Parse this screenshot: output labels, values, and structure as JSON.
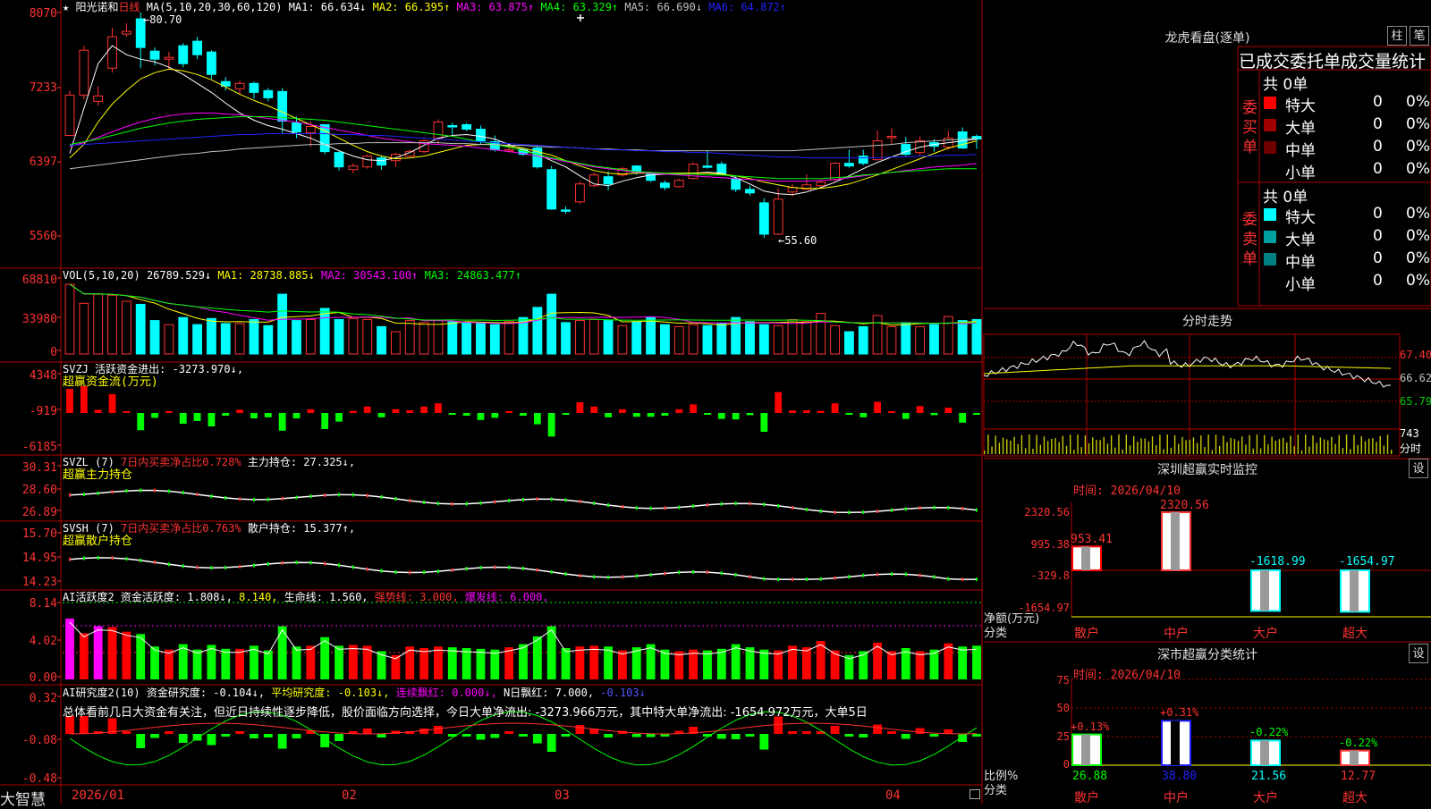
{
  "stock": {
    "star": "★",
    "name": "阳光诺和",
    "period": "日线",
    "ma_header": "MA(5,10,20,30,60,120)",
    "ma_values": [
      {
        "label": "MA1: 66.634↓",
        "color": "#ffffff"
      },
      {
        "label": "MA2: 66.395↑",
        "color": "#ffff00"
      },
      {
        "label": "MA3: 63.875↑",
        "color": "#ff00ff"
      },
      {
        "label": "MA4: 63.329↑",
        "color": "#00ff00"
      },
      {
        "label": "MA5: 66.690↓",
        "color": "#c0c0c0"
      },
      {
        "label": "MA6: 64.872↑",
        "color": "#2222ff"
      }
    ],
    "hi_label": "80.70",
    "lo_label": "55.60",
    "price_axis": [
      "8070",
      "7233",
      "6397",
      "5560"
    ]
  },
  "vol": {
    "header": "VOL(5,10,20)",
    "value": "26789.529↓",
    "ma": [
      {
        "label": "MA1: 28738.885↓",
        "color": "#ffff00"
      },
      {
        "label": "MA2: 30543.100↑",
        "color": "#ff00ff"
      },
      {
        "label": "MA3: 24863.477↑",
        "color": "#00ff00"
      }
    ],
    "axis": [
      "68810",
      "33980",
      "0"
    ]
  },
  "svzj": {
    "header": "SVZJ  活跃资金进出: -3273.970↓,",
    "sub": "超赢资金流(万元)",
    "axis": [
      "4348",
      "-919",
      "-6185"
    ]
  },
  "svzl": {
    "header1": "SVZL (7)",
    "header2": "7日内买卖净占比0.728%",
    "header3": "主力持仓: 27.325↓,",
    "sub": "超赢主力持仓",
    "axis": [
      "30.31",
      "28.60",
      "26.89"
    ]
  },
  "svsh": {
    "header1": "SVSH (7)",
    "header2": "7日内买卖净占比0.763%",
    "header3": "散户持仓: 15.377↑,",
    "sub": "超赢散户持仓",
    "axis": [
      "15.70",
      "14.95",
      "14.23"
    ]
  },
  "ai_active": {
    "header": "AI活跃度2",
    "parts": [
      {
        "label": "资金活跃度: 1.808↓,",
        "color": "#ffffff"
      },
      {
        "label": "8.140,",
        "color": "#ffff00"
      },
      {
        "label": "生命线: 1.560,",
        "color": "#ffffff"
      },
      {
        "label": "强势线: 3.000,",
        "color": "#ff3232"
      },
      {
        "label": "爆发线: 6.000,",
        "color": "#ff00ff"
      }
    ],
    "axis": [
      "8.14",
      "4.02",
      "0.00"
    ]
  },
  "ai_research": {
    "header": "AI研究度2(10)",
    "parts": [
      {
        "label": "资金研究度: -0.104↓,",
        "color": "#ffffff"
      },
      {
        "label": "平均研究度: -0.103↓,",
        "color": "#ffff00"
      },
      {
        "label": "连续飘红: 0.000↓,",
        "color": "#ff00ff"
      },
      {
        "label": "N日飘红: 7.000,",
        "color": "#ffffff"
      },
      {
        "label": "-0.103↓",
        "color": "#5555ff"
      }
    ],
    "description": "总体看前几日大资金有关注，但近日持续性逐步降低，股价面临方向选择，今日大单净流出: -3273.966万元，其中特大单净流出: -1654.972万元，大单5日",
    "axis": [
      "0.32",
      "-0.08",
      "-0.48"
    ]
  },
  "date_axis": [
    "2026/01",
    "02",
    "03",
    "04"
  ],
  "brand": "大智慧",
  "right_panel": {
    "dragon_title": "龙虎看盘(逐单)",
    "tab_zhu": "柱",
    "tab_bi": "笔",
    "table_header": "已成交委托单成交量统计",
    "buy_label": "委买单",
    "sell_label": "委卖单",
    "buy_total": "共 0单",
    "sell_total": "共 0单",
    "buy_rows": [
      {
        "name": "特大",
        "count": "0",
        "pct": "0%",
        "color": "#ff0000"
      },
      {
        "name": "大单",
        "count": "0",
        "pct": "0%",
        "color": "#a00000"
      },
      {
        "name": "中单",
        "count": "0",
        "pct": "0%",
        "color": "#700000"
      },
      {
        "name": "小单",
        "count": "0",
        "pct": "0%",
        "color": "#000000"
      }
    ],
    "sell_rows": [
      {
        "name": "特大",
        "count": "0",
        "pct": "0%",
        "color": "#00ffff"
      },
      {
        "name": "大单",
        "count": "0",
        "pct": "0%",
        "color": "#00a0a0"
      },
      {
        "name": "中单",
        "count": "0",
        "pct": "0%",
        "color": "#008080"
      },
      {
        "name": "小单",
        "count": "0",
        "pct": "0%",
        "color": "#000000"
      }
    ],
    "intraday": {
      "title": "分时走势",
      "price_axis": [
        "67.40",
        "66.62",
        "65.79"
      ],
      "vol_label": "743",
      "unit": "分时"
    },
    "monitor": {
      "title": "深圳超赢实时监控",
      "set": "设",
      "time": "时间: 2026/04/10",
      "axis": [
        "2320.56",
        "995.38",
        "-329.8",
        "-1654.97"
      ],
      "bar_values": [
        "953.41",
        "2320.56",
        "-1618.99",
        "-1654.97"
      ],
      "y_unit1": "净额(万元)",
      "y_unit2": "分类",
      "categories": [
        "散户",
        "中户",
        "大户",
        "超大"
      ]
    },
    "classify": {
      "title": "深市超赢分类统计",
      "set": "设",
      "time": "时间: 2026/04/10",
      "axis": [
        "75",
        "50",
        "25",
        "0"
      ],
      "deltas": [
        "+0.13%",
        "+0.31%",
        "-0.22%",
        "-0.22%"
      ],
      "values": [
        "26.88",
        "38.80",
        "21.56",
        "12.77"
      ],
      "y_unit1": "比例%",
      "y_unit2": "分类",
      "categories": [
        "散户",
        "中户",
        "大户",
        "超大"
      ]
    }
  },
  "chart_data": {
    "type": "candlestick",
    "dates": [
      "2026/01",
      "02",
      "03",
      "04"
    ],
    "ylim": [
      55.6,
      80.7
    ],
    "candles": [
      [
        67.0,
        71.5,
        67.0,
        72.0
      ],
      [
        71.5,
        76.5,
        71.0,
        77.0
      ],
      [
        70.8,
        71.4,
        70.3,
        72.5
      ],
      [
        74.5,
        78.0,
        74.0,
        79.0
      ],
      [
        78.3,
        78.6,
        78.0,
        79.5
      ],
      [
        80.0,
        76.8,
        74.5,
        80.7
      ],
      [
        76.4,
        75.5,
        74.8,
        76.8
      ],
      [
        75.5,
        75.7,
        74.3,
        76.3
      ],
      [
        77.0,
        75.0,
        74.6,
        77.3
      ],
      [
        77.5,
        76.0,
        75.5,
        78.0
      ],
      [
        76.3,
        73.8,
        73.3,
        76.5
      ],
      [
        73.0,
        72.5,
        72.0,
        73.5
      ],
      [
        72.2,
        72.8,
        71.6,
        73.1
      ],
      [
        72.8,
        71.8,
        71.1,
        73.0
      ],
      [
        72.0,
        71.2,
        70.8,
        72.3
      ],
      [
        71.9,
        68.6,
        67.3,
        72.3
      ],
      [
        68.4,
        67.4,
        66.7,
        69.1
      ],
      [
        67.3,
        68.0,
        65.7,
        68.6
      ],
      [
        68.2,
        65.2,
        64.9,
        68.2
      ],
      [
        65.1,
        63.5,
        63.1,
        65.3
      ],
      [
        63.2,
        63.6,
        62.8,
        63.9
      ],
      [
        63.5,
        64.7,
        63.3,
        64.9
      ],
      [
        64.5,
        63.7,
        63.2,
        64.8
      ],
      [
        64.2,
        64.9,
        63.5,
        65.1
      ],
      [
        64.7,
        65.2,
        64.6,
        65.4
      ],
      [
        65.2,
        66.4,
        65.0,
        66.6
      ],
      [
        66.7,
        68.5,
        66.0,
        68.8
      ],
      [
        68.1,
        68.0,
        67.1,
        68.4
      ],
      [
        68.2,
        67.7,
        67.5,
        68.4
      ],
      [
        67.7,
        66.4,
        66.0,
        68.1
      ],
      [
        66.3,
        65.4,
        65.2,
        67.0
      ],
      [
        65.4,
        65.4,
        65.1,
        65.7
      ],
      [
        65.4,
        64.9,
        64.7,
        65.7
      ],
      [
        65.6,
        63.5,
        63.3,
        65.9
      ],
      [
        63.2,
        58.8,
        58.7,
        63.6
      ],
      [
        58.7,
        58.6,
        58.3,
        59.1
      ],
      [
        59.6,
        61.6,
        59.4,
        61.9
      ],
      [
        61.4,
        62.6,
        61.2,
        62.9
      ],
      [
        62.4,
        61.6,
        60.9,
        63.0
      ],
      [
        62.6,
        63.3,
        62.4,
        63.5
      ],
      [
        63.6,
        62.9,
        62.6,
        63.7
      ],
      [
        62.7,
        62.0,
        61.8,
        62.9
      ],
      [
        61.7,
        61.2,
        60.9,
        62.0
      ],
      [
        61.3,
        62.0,
        61.2,
        62.2
      ],
      [
        62.2,
        63.8,
        62.1,
        64.0
      ],
      [
        63.6,
        63.5,
        63.3,
        65.3
      ],
      [
        63.8,
        62.7,
        62.6,
        64.1
      ],
      [
        62.2,
        61.0,
        60.7,
        62.5
      ],
      [
        61.0,
        60.6,
        60.3,
        61.4
      ],
      [
        59.5,
        56.0,
        55.6,
        60.0
      ],
      [
        56.0,
        59.9,
        55.9,
        61.1
      ],
      [
        60.7,
        61.2,
        60.2,
        61.6
      ],
      [
        61.0,
        61.5,
        61.1,
        62.7
      ],
      [
        61.4,
        61.8,
        61.2,
        62.0
      ],
      [
        62.1,
        63.9,
        61.8,
        64.0
      ],
      [
        63.9,
        63.6,
        63.4,
        65.4
      ],
      [
        64.7,
        63.9,
        63.7,
        65.4
      ],
      [
        64.3,
        66.4,
        64.2,
        67.6
      ],
      [
        66.9,
        66.9,
        66.0,
        67.8
      ],
      [
        66.0,
        64.9,
        64.7,
        66.8
      ],
      [
        65.1,
        66.4,
        64.8,
        66.9
      ],
      [
        66.2,
        65.8,
        65.2,
        66.6
      ],
      [
        65.7,
        66.7,
        65.4,
        67.5
      ],
      [
        67.4,
        65.6,
        65.5,
        67.9
      ],
      [
        66.9,
        66.6,
        65.5,
        67.1
      ]
    ],
    "series": [
      {
        "name": "MA1",
        "color": "#ffffff",
        "values": [
          65.0,
          70.0,
          75.0,
          77.0,
          76.0,
          75.5,
          75.2,
          74.6,
          73.8,
          72.8,
          71.8,
          70.6,
          69.5,
          68.7,
          68.1,
          67.7,
          67.2,
          66.7,
          66.0,
          65.3,
          64.7,
          64.3,
          64.2,
          64.5,
          65.1,
          65.9,
          66.7,
          67.0,
          67.1,
          66.9,
          66.6,
          66.0,
          65.4,
          64.9,
          64.2,
          63.5,
          62.5,
          61.6,
          61.4,
          61.9,
          62.3,
          62.6,
          62.7,
          62.7,
          62.8,
          62.9,
          62.8,
          62.3,
          61.6,
          60.8,
          60.5,
          60.4,
          60.7,
          61.2,
          61.8,
          62.5,
          63.3,
          64.0,
          64.6,
          65.2,
          65.7,
          66.0,
          66.2,
          66.4,
          66.6
        ]
      },
      {
        "name": "MA2",
        "color": "#ffff00",
        "values": [
          64.5,
          66.0,
          68.5,
          70.5,
          72.0,
          73.3,
          74.0,
          74.4,
          74.2,
          73.8,
          73.2,
          72.4,
          71.6,
          70.9,
          70.3,
          69.6,
          68.9,
          68.2,
          67.5,
          66.7,
          65.9,
          65.2,
          64.7,
          64.4,
          64.5,
          64.7,
          65.1,
          65.5,
          65.9,
          66.0,
          66.0,
          65.8,
          65.6,
          65.2,
          64.8,
          64.2,
          63.6,
          63.1,
          62.8,
          62.7,
          62.8,
          62.8,
          62.8,
          62.8,
          62.8,
          62.8,
          62.7,
          62.5,
          62.2,
          61.8,
          61.5,
          61.2,
          61.1,
          61.1,
          61.3,
          61.6,
          62.1,
          62.6,
          63.2,
          63.8,
          64.4,
          65.0,
          65.6,
          66.0,
          66.4
        ]
      },
      {
        "name": "MA3",
        "color": "#ff00ff",
        "values": [
          65.8,
          66.2,
          66.8,
          67.4,
          68.0,
          68.5,
          68.9,
          69.2,
          69.4,
          69.5,
          69.5,
          69.4,
          69.3,
          69.1,
          68.9,
          68.7,
          68.5,
          68.2,
          67.9,
          67.6,
          67.3,
          67.0,
          66.7,
          66.5,
          66.3,
          66.1,
          66.0,
          65.9,
          65.8,
          65.6,
          65.4,
          65.2,
          65.0,
          64.7,
          64.4,
          64.1,
          63.8,
          63.5,
          63.3,
          63.1,
          62.9,
          62.8,
          62.7,
          62.6,
          62.5,
          62.4,
          62.3,
          62.2,
          62.1,
          62.0,
          61.9,
          61.9,
          61.9,
          62.0,
          62.1,
          62.3,
          62.5,
          62.7,
          62.9,
          63.1,
          63.3,
          63.5,
          63.6,
          63.7,
          63.9
        ]
      },
      {
        "name": "MA4",
        "color": "#00ff00",
        "values": [
          66.0,
          66.3,
          66.6,
          67.0,
          67.4,
          67.8,
          68.1,
          68.4,
          68.6,
          68.8,
          68.9,
          69.0,
          69.1,
          69.1,
          69.1,
          69.0,
          68.9,
          68.8,
          68.7,
          68.5,
          68.3,
          68.1,
          67.9,
          67.7,
          67.5,
          67.3,
          67.1,
          66.9,
          66.6,
          66.3,
          66.0,
          65.7,
          65.3,
          64.9,
          64.5,
          64.2,
          63.9,
          63.6,
          63.4,
          63.2,
          63.0,
          62.9,
          62.8,
          62.7,
          62.7,
          62.6,
          62.6,
          62.5,
          62.4,
          62.3,
          62.2,
          62.2,
          62.2,
          62.2,
          62.3,
          62.4,
          62.6,
          62.7,
          62.9,
          63.0,
          63.1,
          63.2,
          63.3,
          63.3,
          63.3
        ]
      },
      {
        "name": "MA5",
        "color": "#c0c0c0",
        "values": [
          63.3,
          63.5,
          63.7,
          63.9,
          64.1,
          64.3,
          64.5,
          64.7,
          64.9,
          65.0,
          65.2,
          65.3,
          65.5,
          65.6,
          65.7,
          65.8,
          65.9,
          66.0,
          66.0,
          66.1,
          66.1,
          66.2,
          66.2,
          66.2,
          66.2,
          66.2,
          66.2,
          66.1,
          66.1,
          66.0,
          66.0,
          65.9,
          65.9,
          65.8,
          65.7,
          65.7,
          65.6,
          65.5,
          65.5,
          65.4,
          65.4,
          65.3,
          65.3,
          65.3,
          65.3,
          65.3,
          65.3,
          65.3,
          65.3,
          65.3,
          65.3,
          65.3,
          65.4,
          65.5,
          65.6,
          65.7,
          65.8,
          65.9,
          66.0,
          66.2,
          66.3,
          66.4,
          66.5,
          66.6,
          66.7
        ]
      },
      {
        "name": "MA6",
        "color": "#2222ff",
        "values": [
          65.9,
          66.0,
          66.1,
          66.2,
          66.3,
          66.4,
          66.5,
          66.6,
          66.7,
          66.8,
          66.9,
          67.0,
          67.1,
          67.1,
          67.2,
          67.2,
          67.2,
          67.2,
          67.2,
          67.1,
          67.1,
          67.0,
          67.0,
          66.9,
          66.8,
          66.7,
          66.6,
          66.5,
          66.4,
          66.3,
          66.2,
          66.1,
          66.0,
          65.9,
          65.8,
          65.7,
          65.6,
          65.5,
          65.4,
          65.4,
          65.3,
          65.3,
          65.2,
          65.2,
          65.1,
          65.1,
          65.0,
          64.9,
          64.8,
          64.7,
          64.6,
          64.6,
          64.5,
          64.5,
          64.5,
          64.5,
          64.5,
          64.5,
          64.6,
          64.6,
          64.7,
          64.7,
          64.8,
          64.8,
          64.9
        ]
      }
    ],
    "volume": [
      68810,
      50000,
      59000,
      58000,
      52000,
      49000,
      33000,
      29000,
      36000,
      29000,
      35000,
      30000,
      30000,
      34000,
      28000,
      59000,
      33000,
      34000,
      45000,
      34000,
      35000,
      34000,
      27000,
      22000,
      33000,
      31000,
      33000,
      32000,
      31000,
      30000,
      29000,
      32000,
      36000,
      46000,
      59000,
      31000,
      33000,
      34000,
      33000,
      28000,
      32000,
      36000,
      29000,
      27000,
      29000,
      28000,
      30000,
      36000,
      32000,
      29000,
      28000,
      34000,
      32000,
      40000,
      28000,
      22000,
      27000,
      38000,
      27000,
      31000,
      27000,
      29000,
      37000,
      33000,
      34000
    ]
  }
}
